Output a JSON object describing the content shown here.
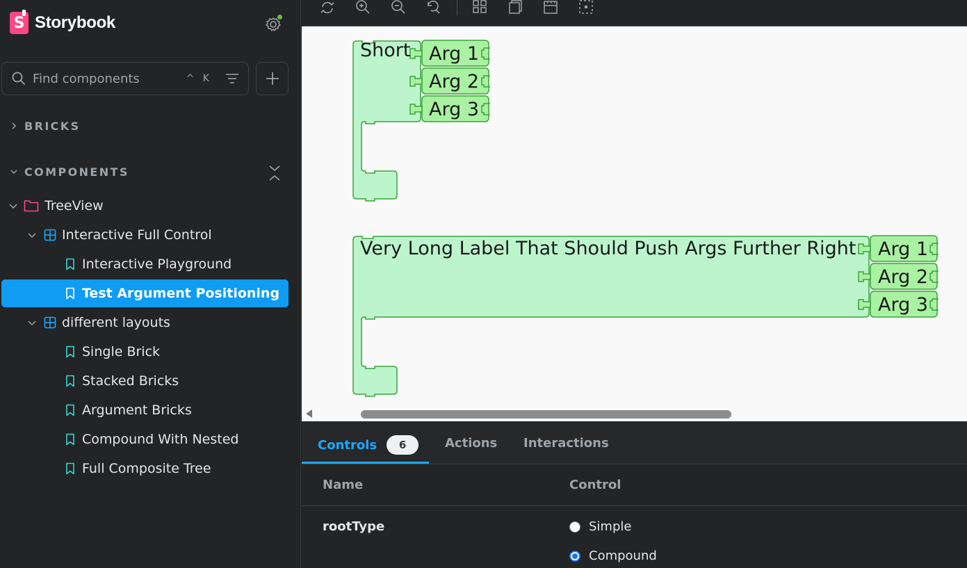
{
  "app": {
    "brand_name": "Storybook",
    "brand_letter": "S"
  },
  "search": {
    "placeholder": "Find components",
    "shortcut": "^ K"
  },
  "sidebar": {
    "sections": {
      "bricks": "BRICKS",
      "components": "COMPONENTS"
    },
    "tree": {
      "root": "TreeView",
      "group1": "Interactive Full Control",
      "group1_items": [
        "Interactive Playground",
        "Test Argument Positioning"
      ],
      "group2": "different layouts",
      "group2_items": [
        "Single Brick",
        "Stacked Bricks",
        "Argument Bricks",
        "Compound With Nested",
        "Full Composite Tree"
      ]
    },
    "selected": "Test Argument Positioning"
  },
  "canvas": {
    "brick1": {
      "label": "Short",
      "args": [
        "Arg 1",
        "Arg 2",
        "Arg 3"
      ]
    },
    "brick2": {
      "label": "Very Long Label That Should Push Args Further Right",
      "args": [
        "Arg 1",
        "Arg 2",
        "Arg 3"
      ]
    }
  },
  "panel": {
    "tabs": {
      "controls": "Controls",
      "controls_count": "6",
      "actions": "Actions",
      "interactions": "Interactions"
    },
    "headers": {
      "name": "Name",
      "control": "Control"
    },
    "rows": [
      {
        "name": "rootType",
        "options": [
          "Simple",
          "Compound"
        ],
        "selected": "Compound"
      }
    ]
  },
  "colors": {
    "accent": "#1ea7fd",
    "selected_bg": "#0f9cf2",
    "brand": "#ff4785",
    "brick_fill": "#bcf5cc",
    "arg_fill": "#a9f2a2",
    "brick_stroke": "#3aa33a"
  }
}
